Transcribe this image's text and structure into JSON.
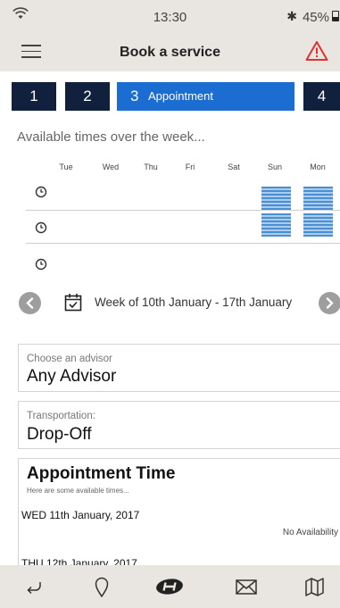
{
  "status_bar": {
    "time": "13:30",
    "battery": "45%"
  },
  "header": {
    "title": "Book a service"
  },
  "steps": [
    {
      "number": "1"
    },
    {
      "number": "2"
    },
    {
      "number": "3",
      "label": "Appointment",
      "active": true
    },
    {
      "number": "4"
    }
  ],
  "availability": {
    "title": "Available times over the week...",
    "days": [
      "Tue",
      "Wed",
      "Thu",
      "Fri",
      "Sat",
      "Sun",
      "Mon"
    ],
    "rows": [
      {
        "available_days": [
          "Sun",
          "Mon"
        ]
      },
      {
        "available_days": [
          "Sun",
          "Mon"
        ]
      },
      {
        "available_days": []
      }
    ],
    "week_label": "Week of 10th January - 17th January"
  },
  "advisor": {
    "label": "Choose an advisor",
    "value": "Any Advisor"
  },
  "transportation": {
    "label": "Transportation:",
    "value": "Drop-Off"
  },
  "appointment_time": {
    "heading": "Appointment Time",
    "subheading": "Here are some available times...",
    "dates": [
      {
        "date": "WED 11th January, 2017",
        "status": "No Availability"
      },
      {
        "date": "THU 12th January, 2017"
      }
    ]
  },
  "colors": {
    "active_step": "#1c6dd2",
    "step": "#11203d",
    "slot": "#4a8fd1",
    "warning": "#e0322d",
    "bar": "#e9e6e2"
  },
  "icons": {
    "menu": "hamburger-icon",
    "warning": "warning-triangle-icon",
    "nav": [
      "back-arrow-icon",
      "location-pin-icon",
      "hyundai-logo-icon",
      "mail-icon",
      "map-icon"
    ]
  }
}
